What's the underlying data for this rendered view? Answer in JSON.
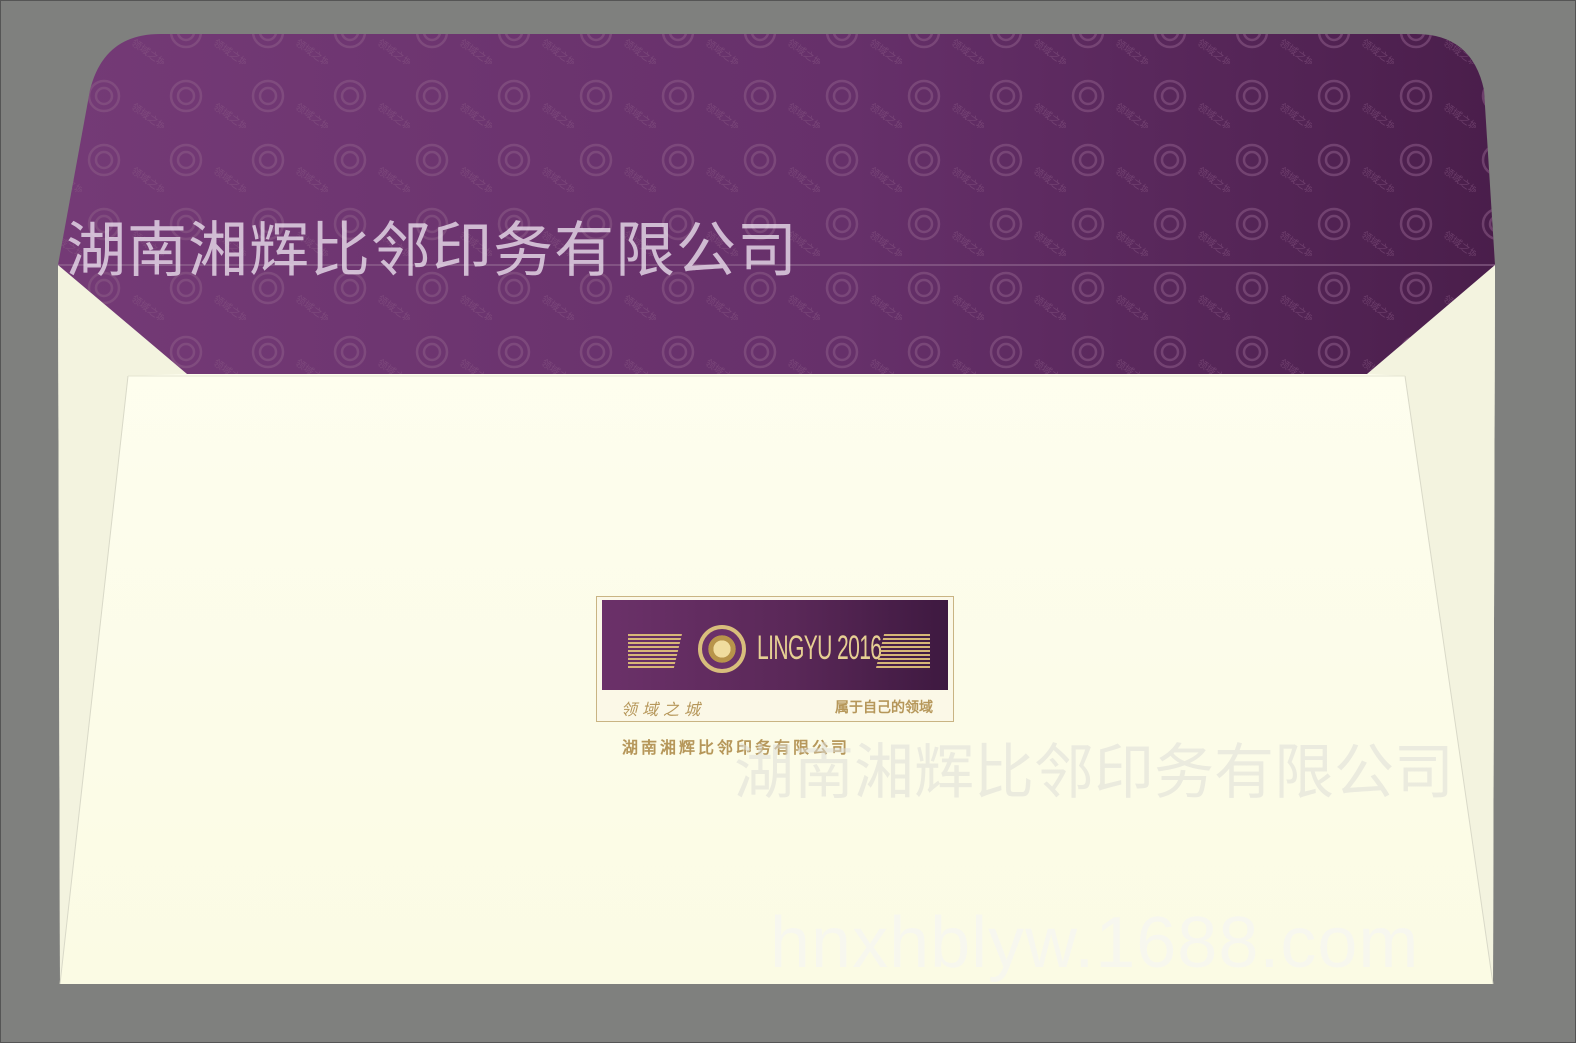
{
  "envelope": {
    "colors": {
      "background": "#7f807e",
      "paper": "#fefee8",
      "flap_purple_light": "#6e3470",
      "flap_purple_dark": "#4a1e4a",
      "gold": "#b6975a"
    }
  },
  "label": {
    "brand": "LINGYU 2016",
    "left_caption": "领域之城",
    "right_caption": "属于自己的领域"
  },
  "company_line": "湖南湘辉比邻印务有限公司",
  "watermarks": {
    "flap_text": "湖南湘辉比邻印务有限公司",
    "body_text": "湖南湘辉比邻印务有限公司",
    "url": "hnxhblyw.1688.com"
  }
}
